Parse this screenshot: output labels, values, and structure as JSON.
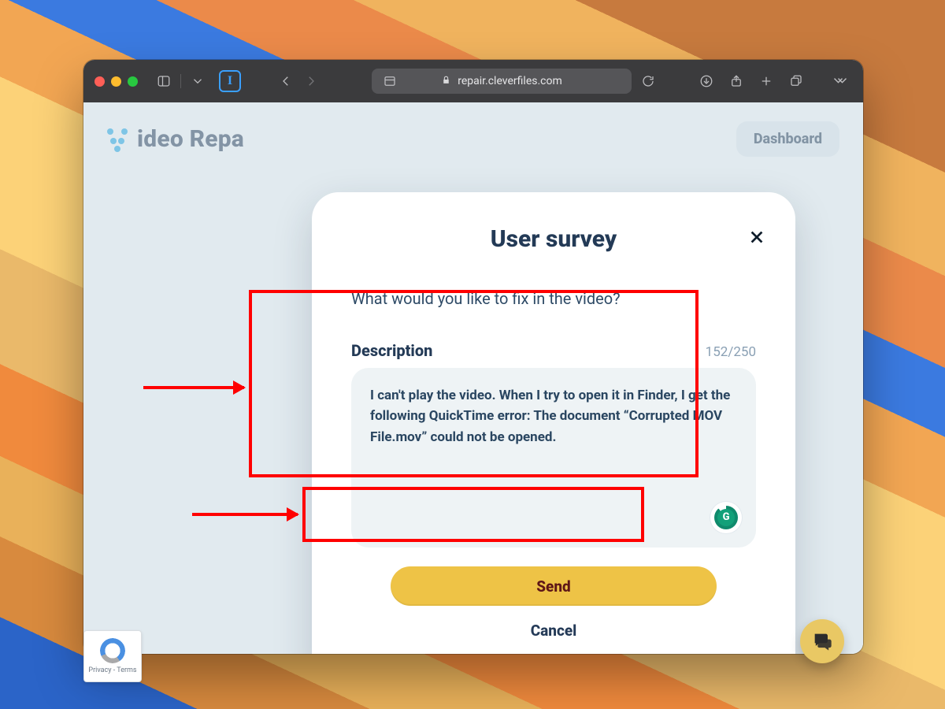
{
  "browser": {
    "url_host": "repair.cleverfiles.com",
    "extension_badge": "I"
  },
  "page": {
    "brand_text": "ideo Repa",
    "dashboard_label": "Dashboard"
  },
  "modal": {
    "title": "User survey",
    "question": "What would you like to fix in the video?",
    "description_label": "Description",
    "char_counter": "152/250",
    "textarea_value": "I can't play the video. When I try to open it in Finder, I get the following QuickTime error: The document “Corrupted MOV File.mov” could not be opened.",
    "send_label": "Send",
    "cancel_label": "Cancel",
    "grammarly_letter": "G"
  },
  "recaptcha": {
    "caption": "Privacy - Terms"
  },
  "colors": {
    "accent_yellow": "#eec346",
    "text_navy": "#243a57",
    "red": "#ff0000"
  }
}
